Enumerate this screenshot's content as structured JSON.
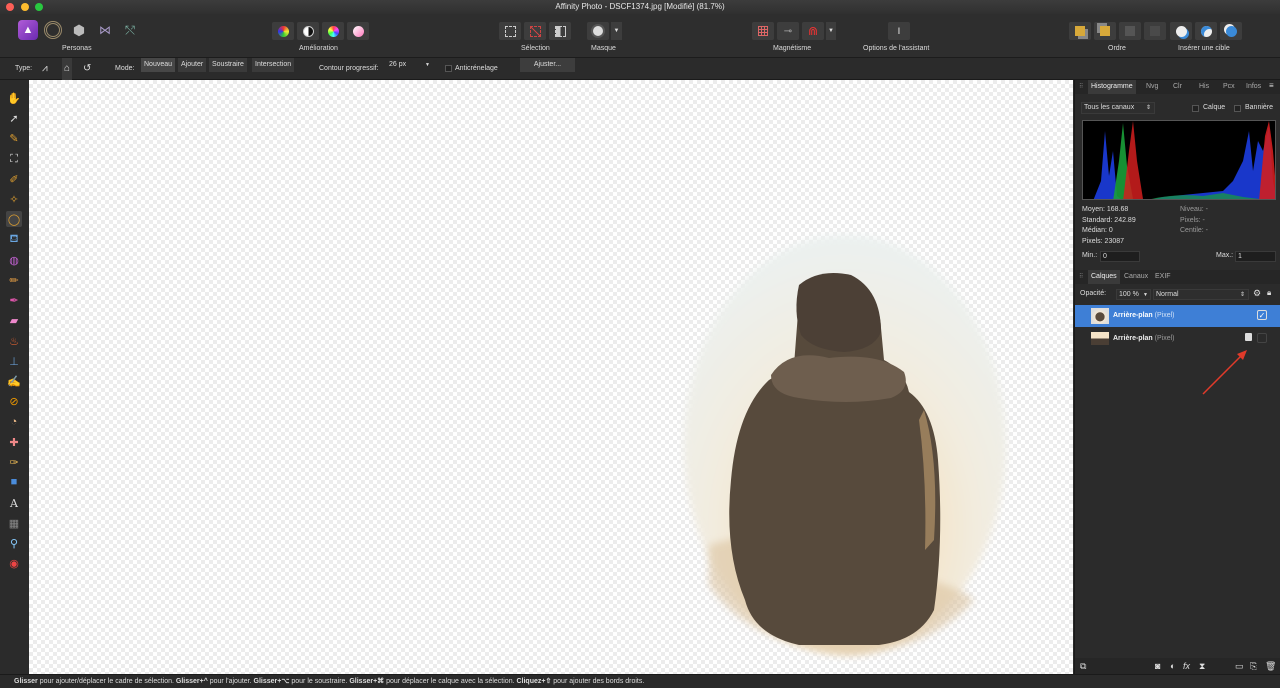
{
  "window": {
    "title": "Affinity Photo - DSCF1374.jpg [Modifié] (81.7%)"
  },
  "toolbar": {
    "personas_label": "Personas",
    "amelioration_label": "Amélioration",
    "selection_label": "Sélection",
    "masque_label": "Masque",
    "magnetisme_label": "Magnétisme",
    "assistant_label": "Options de l'assistant",
    "ordre_label": "Ordre",
    "inserer_label": "Insérer une cible"
  },
  "context": {
    "type_label": "Type:",
    "mode_label": "Mode:",
    "modes": [
      "Nouveau",
      "Ajouter",
      "Soustraire",
      "Intersection"
    ],
    "feather_label": "Contour progressif:",
    "feather_value": "26 px",
    "antialias_label": "Anticrénelage",
    "adjust_button": "Ajuster..."
  },
  "histogram_panel": {
    "tabs": [
      "Histogramme",
      "Nvg",
      "Clr",
      "His",
      "Pcx",
      "Infos"
    ],
    "channel": "Tous les canaux",
    "calque_label": "Calque",
    "banniere_label": "Bannière",
    "stats_left": [
      "Moyen: 168.68",
      "Standard: 242.89",
      "Médian: 0",
      "Pixels: 23087"
    ],
    "stats_right": [
      "Niveau: -",
      "Pixels: -",
      "Centile: -"
    ],
    "min_label": "Min.:",
    "min_value": "0",
    "max_label": "Max.:",
    "max_value": "1"
  },
  "layers_panel": {
    "tabs": [
      "Calques",
      "Canaux",
      "EXIF"
    ],
    "opacity_label": "Opacité:",
    "opacity_value": "100 %",
    "blend_mode": "Normal",
    "layers": [
      {
        "name": "Arrière-plan",
        "type": "(Pixel)",
        "selected": true
      },
      {
        "name": "Arrière-plan",
        "type": "(Pixel)",
        "selected": false,
        "locked": true
      }
    ]
  },
  "status": {
    "parts": [
      {
        "b": "Glisser",
        "t": " pour ajouter/déplacer le cadre de sélection. "
      },
      {
        "b": "Glisser+^",
        "t": " pour l'ajouter. "
      },
      {
        "b": "Glisser+⌥",
        "t": " pour le soustraire. "
      },
      {
        "b": "Glisser+⌘",
        "t": " pour déplacer le calque avec la sélection. "
      },
      {
        "b": "Cliquez+⇧",
        "t": " pour ajouter des bords droits."
      }
    ]
  },
  "colors": {
    "accent": "#3e7fd6",
    "arrow": "#e03a2a"
  }
}
